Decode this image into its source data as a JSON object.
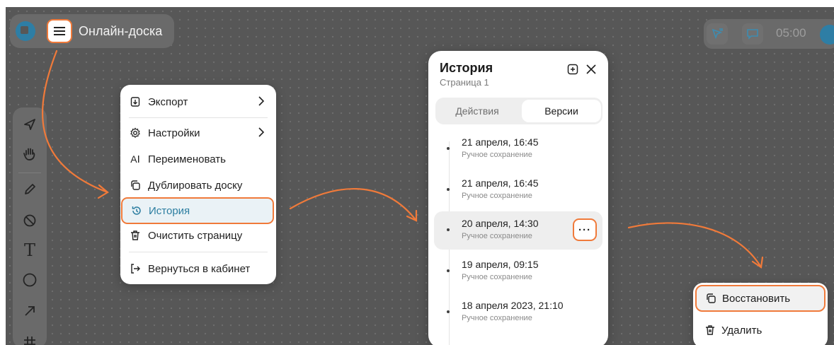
{
  "header": {
    "board_name": "Онлайн-доска",
    "timer": "05:00"
  },
  "main_menu": {
    "items": [
      {
        "label": "Экспорт",
        "icon": "export-icon",
        "submenu": true
      },
      {
        "label": "Настройки",
        "icon": "settings-icon",
        "submenu": true
      },
      {
        "label": "Переименовать",
        "icon": "rename-icon",
        "submenu": false
      },
      {
        "label": "Дублировать доску",
        "icon": "duplicate-icon",
        "submenu": false
      },
      {
        "label": "История",
        "icon": "history-icon",
        "submenu": false,
        "highlighted": true
      },
      {
        "label": "Очистить страницу",
        "icon": "trash-icon",
        "submenu": false
      },
      {
        "label": "Вернуться в кабинет",
        "icon": "exit-icon",
        "submenu": false
      }
    ]
  },
  "history": {
    "title": "История",
    "subtitle": "Страница 1",
    "tabs": [
      {
        "label": "Действия",
        "active": false
      },
      {
        "label": "Версии",
        "active": true
      }
    ],
    "versions": [
      {
        "date": "21 апреля, 16:45",
        "kind": "Ручное сохранение"
      },
      {
        "date": "21 апреля, 16:45",
        "kind": "Ручное сохранение"
      },
      {
        "date": "20 апреля, 14:30",
        "kind": "Ручное сохранение",
        "selected": true
      },
      {
        "date": "19 апреля, 09:15",
        "kind": "Ручное сохранение"
      },
      {
        "date": "18 апреля 2023,  21:10",
        "kind": "Ручное сохранение"
      }
    ],
    "more_label": "···"
  },
  "context_menu": {
    "restore": "Восстановить",
    "delete": "Удалить"
  },
  "colors": {
    "accent_orange": "#f07a3a",
    "brand_blue": "#2e7ea5",
    "canvas": "#575757"
  }
}
